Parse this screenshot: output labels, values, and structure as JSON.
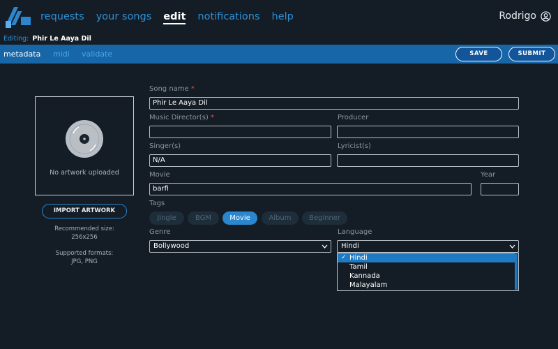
{
  "nav": {
    "items": [
      "requests",
      "your songs",
      "edit",
      "notifications",
      "help"
    ],
    "active_index": 2,
    "user_name": "Rodrigo"
  },
  "editing": {
    "label": "Editing:",
    "title": "Phir Le Aaya Dil"
  },
  "subbar": {
    "tabs": [
      "metadata",
      "midi",
      "validate"
    ],
    "save_label": "SAVE",
    "submit_label": "SUBMIT"
  },
  "artwork": {
    "empty_text": "No artwork uploaded",
    "import_label": "IMPORT ARTWORK",
    "size_hint": [
      "Recommended size:",
      "256x256"
    ],
    "format_hint": [
      "Supported formats:",
      "JPG, PNG"
    ]
  },
  "form": {
    "song_name": {
      "label": "Song name",
      "required_mark": "*",
      "value": "Phir Le Aaya Dil"
    },
    "music_director": {
      "label": "Music Director(s)",
      "required_mark": "*",
      "value": ""
    },
    "producer": {
      "label": "Producer",
      "value": ""
    },
    "singer": {
      "label": "Singer(s)",
      "value": "N/A"
    },
    "lyricist": {
      "label": "Lyricist(s)",
      "value": ""
    },
    "movie": {
      "label": "Movie",
      "value": "barfi"
    },
    "year": {
      "label": "Year",
      "value": ""
    },
    "tags": {
      "label": "Tags",
      "items": [
        "Jingle",
        "BGM",
        "Movie",
        "Album",
        "Beginner"
      ],
      "selected": "Movie"
    },
    "genre": {
      "label": "Genre",
      "value": "Bollywood"
    },
    "language": {
      "label": "Language",
      "value": "Hindi",
      "options": [
        "Hindi",
        "Tamil",
        "Kannada",
        "Malayalam"
      ],
      "check_mark": "✓"
    }
  },
  "colors": {
    "background": "#141d26",
    "accent": "#2e8fd6",
    "subbar": "#1767a8",
    "selected_option": "#1f7ac4"
  }
}
